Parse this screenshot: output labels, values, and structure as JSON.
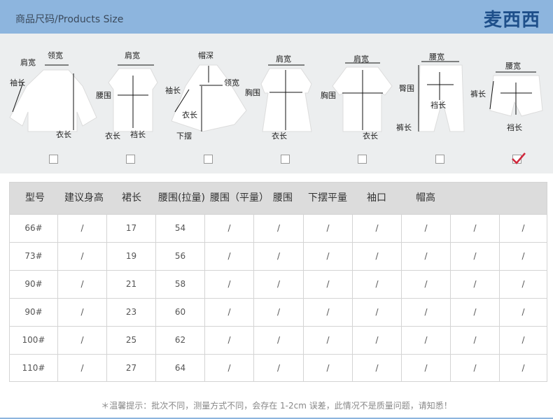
{
  "header": {
    "title": "商品尺码/Products Size",
    "brand": "麦西西"
  },
  "diagrams": {
    "coat": {
      "shoulder": "肩宽",
      "collar": "领宽",
      "sleeve": "袖长",
      "length": "衣长"
    },
    "vest": {
      "shoulder": "肩宽",
      "waist": "腰围",
      "length": "衣长",
      "sleeve": "裆长"
    },
    "cape": {
      "hood": "帽深",
      "sleeve": "袖长",
      "collar": "领宽",
      "length": "衣长",
      "hem": "下摆"
    },
    "dress": {
      "shoulder": "肩宽",
      "chest": "胸围",
      "length": "衣长"
    },
    "tshirt": {
      "shoulder": "肩宽",
      "chest": "胸围",
      "length": "衣长"
    },
    "pants": {
      "waist": "腰宽",
      "hip": "臀围",
      "crotch": "裆长",
      "length": "裤长"
    },
    "shorts": {
      "waist": "腰宽",
      "length": "裤长",
      "crotch": "裆长"
    }
  },
  "checkboxes": [
    false,
    false,
    false,
    false,
    false,
    false,
    true
  ],
  "table": {
    "headers": [
      "型号",
      "建议身高",
      "裙长",
      "腰围(拉量)",
      "腰围（平量）",
      "腰围",
      "下摆平量",
      "袖口",
      "帽高",
      "",
      ""
    ],
    "rows": [
      [
        "66#",
        "/",
        "17",
        "54",
        "/",
        "/",
        "/",
        "/",
        "/",
        "/",
        "/"
      ],
      [
        "73#",
        "/",
        "19",
        "56",
        "/",
        "/",
        "/",
        "/",
        "/",
        "/",
        "/"
      ],
      [
        "90#",
        "/",
        "21",
        "58",
        "/",
        "/",
        "/",
        "/",
        "/",
        "/",
        "/"
      ],
      [
        "90#",
        "/",
        "23",
        "60",
        "/",
        "/",
        "/",
        "/",
        "/",
        "/",
        "/"
      ],
      [
        "100#",
        "/",
        "25",
        "62",
        "/",
        "/",
        "/",
        "/",
        "/",
        "/",
        "/"
      ],
      [
        "110#",
        "/",
        "27",
        "64",
        "/",
        "/",
        "/",
        "/",
        "/",
        "/",
        "/"
      ]
    ]
  },
  "footnote": "＊温馨提示：批次不同，测量方式不同，会存在 1-2cm 误差，此情况不是质量问题，请知悉！"
}
